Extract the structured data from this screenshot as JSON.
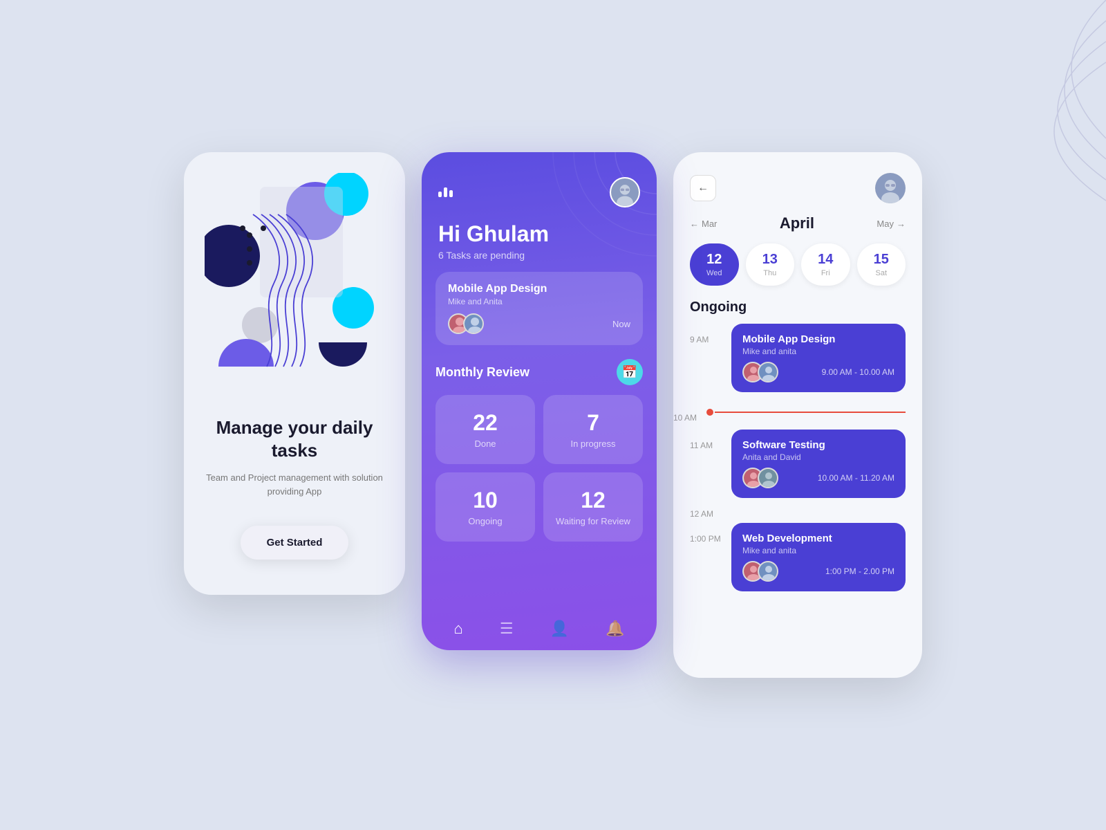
{
  "screen1": {
    "title": "Manage your daily tasks",
    "subtitle": "Team and Project management with solution providing App",
    "cta_label": "Get Started"
  },
  "screen2": {
    "greeting": "Hi Ghulam",
    "tasks_pending": "6 Tasks are pending",
    "task_card": {
      "title": "Mobile App Design",
      "assignees": "Mike and Anita",
      "time": "Now"
    },
    "monthly_review": {
      "title": "Monthly Review",
      "stats": [
        {
          "number": "22",
          "label": "Done"
        },
        {
          "number": "7",
          "label": "In progress"
        },
        {
          "number": "10",
          "label": "Ongoing"
        },
        {
          "number": "12",
          "label": "Waiting for Review"
        }
      ]
    },
    "nav_items": [
      "home",
      "document",
      "person",
      "bell"
    ]
  },
  "screen3": {
    "month": "April",
    "prev_month": "Mar",
    "next_month": "May",
    "dates": [
      {
        "num": "12",
        "day": "Wed",
        "active": true
      },
      {
        "num": "13",
        "day": "Thu",
        "active": false
      },
      {
        "num": "14",
        "day": "Fri",
        "active": false
      },
      {
        "num": "15",
        "day": "Sat",
        "active": false
      }
    ],
    "ongoing_label": "Ongoing",
    "events": [
      {
        "time": "9 AM",
        "title": "Mobile App Design",
        "assignees": "Mike and anita",
        "time_range": "9.00 AM - 10.00 AM"
      },
      {
        "time": "10 AM",
        "current_time": true
      },
      {
        "time": "11 AM",
        "title": "Software Testing",
        "assignees": "Anita and David",
        "time_range": "10.00 AM - 11.20 AM"
      },
      {
        "time": "1:00 PM",
        "title": "Web Development",
        "assignees": "Mike and anita",
        "time_range": "1:00 PM - 2.00 PM"
      }
    ]
  }
}
